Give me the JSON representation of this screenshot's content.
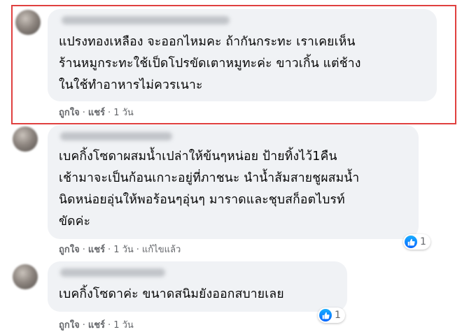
{
  "comments": [
    {
      "lines": [
        "แปรงทองเหลือง จะออกไหมคะ ถ้ากันกระทะ เราเคยเห็น",
        "ร้านหมูกระทะใช้เป็ดโปรขัดเตาหมูทะค่ะ ขาวเกิ้น แต่ช้าง",
        "ในใช้ทำอาหารไม่ควรเนาะ"
      ],
      "like": "ถูกใจ",
      "share": "แชร์",
      "time": "1 วัน"
    },
    {
      "lines": [
        "เบคกิ้งโซดาผสมน้ำเปล่าให้ข้นๆหน่อย ป้ายทิ้งไว้1คืน",
        "เช้ามาจะเป็นก้อนเกาะอยู่ที่ภาชนะ นำน้ำส้มสายชูผสมน้ำ",
        "นิดหน่อยอุ่นให้พอร้อนๆอุ่นๆ มาราดและชุบสก็อตไบรท์",
        "ขัดค่ะ"
      ],
      "like": "ถูกใจ",
      "share": "แชร์",
      "time": "1 วัน",
      "edited": "แก้ไขแล้ว",
      "reaction_count": "1"
    },
    {
      "lines": [
        "เบคกิ้งโซดาค่ะ ขนาดสนิมยังออกสบายเลย"
      ],
      "like": "ถูกใจ",
      "share": "แชร์",
      "time": "1 วัน",
      "reaction_count": "1"
    }
  ],
  "icons": {
    "reaction": "like-thumb-icon"
  },
  "colors": {
    "highlight": "#e0403f",
    "like_blue": "#0866ff",
    "bubble": "#f0f2f5"
  }
}
